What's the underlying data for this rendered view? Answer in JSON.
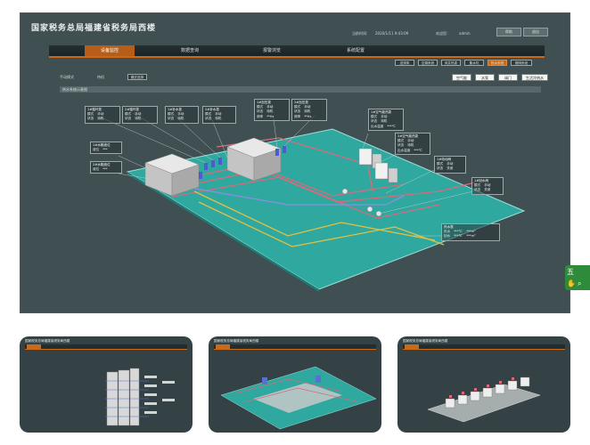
{
  "header": {
    "title": "国家税务总局福建省税务局西楼",
    "time_label": "当前时间:",
    "time_value": "2020/1/11 9:43:09",
    "user_label": "欢迎您：",
    "user_value": "admin",
    "btn_help": "帮助",
    "btn_exit": "退出"
  },
  "nav": {
    "tabs": [
      {
        "label": "设备监控",
        "active": true
      },
      {
        "label": "数据查询",
        "active": false
      },
      {
        "label": "报警浏览",
        "active": false
      },
      {
        "label": "系统配置",
        "active": false
      }
    ]
  },
  "subbar": {
    "mode_label": "手动模式",
    "mode_value": "待机",
    "mode_chip": "模式选择",
    "chips": [
      {
        "label": "送排风",
        "active": false
      },
      {
        "label": "空调系统",
        "active": false
      },
      {
        "label": "风井热泵",
        "active": false
      },
      {
        "label": "集水坑",
        "active": false
      },
      {
        "label": "热水系统",
        "active": true
      },
      {
        "label": "照明系统",
        "active": false
      }
    ],
    "buttons": [
      "空气能",
      "水泵",
      "阀门",
      "生活冷热水"
    ]
  },
  "panel_title": "热水系统示意图",
  "panels": {
    "pump1": {
      "title": "1#循环泵",
      "rows": [
        [
          "模式",
          "手动"
        ],
        [
          "状态",
          "待机"
        ]
      ]
    },
    "pump2": {
      "title": "2#循环泵",
      "rows": [
        [
          "模式",
          "手动"
        ],
        [
          "状态",
          "待机"
        ]
      ]
    },
    "pump3": {
      "title": "1#补水泵",
      "rows": [
        [
          "模式",
          "手动"
        ],
        [
          "状态",
          "待机"
        ]
      ]
    },
    "pump4": {
      "title": "2#补水泵",
      "rows": [
        [
          "模式",
          "手动"
        ],
        [
          "状态",
          "待机"
        ]
      ]
    },
    "pump5": {
      "title": "1#加压泵",
      "rows": [
        [
          "模式",
          "手动"
        ],
        [
          "状态",
          "待机"
        ],
        [
          "频率",
          "**Hz"
        ]
      ]
    },
    "pump6": {
      "title": "2#加压泵",
      "rows": [
        [
          "模式",
          "手动"
        ],
        [
          "状态",
          "待机"
        ],
        [
          "频率",
          "**Hz"
        ]
      ]
    },
    "tank1": {
      "title": "1#水箱液位",
      "rows": [
        [
          "液位",
          "***"
        ]
      ]
    },
    "tank2": {
      "title": "2#水箱液位",
      "rows": [
        [
          "液位",
          "***"
        ]
      ]
    },
    "air1": {
      "title": "1#空气能热泵",
      "rows": [
        [
          "模式",
          "手动"
        ],
        [
          "状态",
          "待机"
        ],
        [
          "出水温度",
          "***℃"
        ]
      ]
    },
    "air2": {
      "title": "2#空气能热泵",
      "rows": [
        [
          "模式",
          "手动"
        ],
        [
          "状态",
          "待机"
        ],
        [
          "出水温度",
          "***℃"
        ]
      ]
    },
    "valve1": {
      "title": "1#电动阀",
      "rows": [
        [
          "模式",
          "手动"
        ],
        [
          "状态",
          "关闭"
        ]
      ]
    },
    "valve2": {
      "title": "1#回水阀",
      "rows": [
        [
          "模式",
          "手动"
        ],
        [
          "状态",
          "关闭"
        ]
      ]
    },
    "hotwater": {
      "title": "热水表",
      "rows": [
        [
          "供水",
          "***℃",
          "***m³"
        ],
        [
          "回水",
          "***℃",
          "***m³"
        ]
      ]
    }
  },
  "thumbnails": [
    {
      "title": "国家税务总局福建省税务局西楼"
    },
    {
      "title": "国家税务总局福建省税务局西楼"
    },
    {
      "title": "国家税务总局福建省税务局西楼"
    }
  ],
  "side_widget": {
    "line1": "五",
    "icon1": "hand-icon",
    "icon2": "search-icon"
  },
  "colors": {
    "accent": "#c96a18",
    "floor": "#2fa8a0",
    "background": "#3f4f52"
  }
}
